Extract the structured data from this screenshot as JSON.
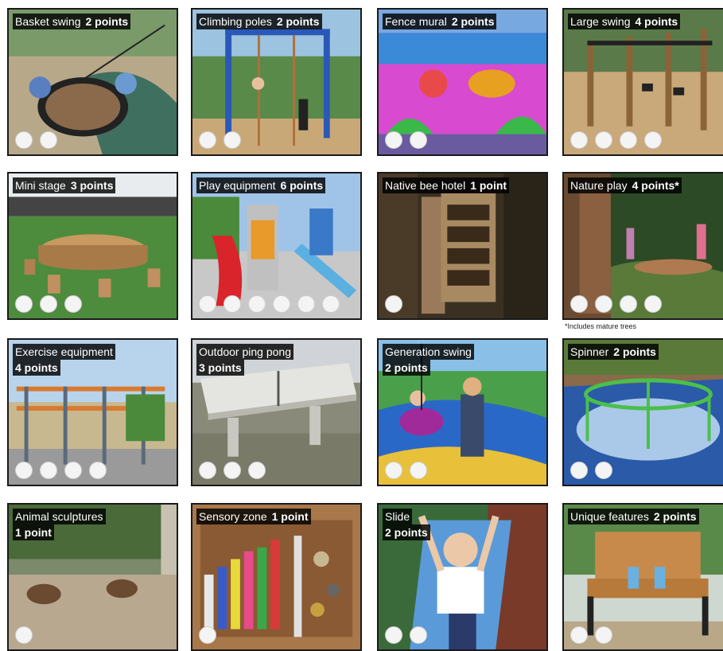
{
  "cards": [
    {
      "name": "Basket swing",
      "points": "2 points",
      "dots": 2,
      "two_line": false
    },
    {
      "name": "Climbing poles",
      "points": "2 points",
      "dots": 2,
      "two_line": false
    },
    {
      "name": "Fence mural",
      "points": "2 points",
      "dots": 2,
      "two_line": false
    },
    {
      "name": "Large swing",
      "points": "4 points",
      "dots": 4,
      "two_line": false
    },
    {
      "name": "Mini stage",
      "points": "3 points",
      "dots": 3,
      "two_line": false
    },
    {
      "name": "Play equipment",
      "points": "6 points",
      "dots": 6,
      "two_line": false
    },
    {
      "name": "Native bee hotel",
      "points": "1 point",
      "dots": 1,
      "two_line": false
    },
    {
      "name": "Nature play",
      "points": "4 points*",
      "dots": 4,
      "two_line": false
    },
    {
      "name": "Exercise equipment",
      "points": "4 points",
      "dots": 4,
      "two_line": true
    },
    {
      "name": "Outdoor ping pong",
      "points": "3 points",
      "dots": 3,
      "two_line": true
    },
    {
      "name": "Generation swing",
      "points": "2 points",
      "dots": 2,
      "two_line": true
    },
    {
      "name": "Spinner",
      "points": "2 points",
      "dots": 2,
      "two_line": false
    },
    {
      "name": "Animal sculptures",
      "points": "1 point",
      "dots": 1,
      "two_line": true
    },
    {
      "name": "Sensory zone",
      "points": "1 point",
      "dots": 1,
      "two_line": false
    },
    {
      "name": "Slide",
      "points": "2 points",
      "dots": 2,
      "two_line": true
    },
    {
      "name": "Unique features",
      "points": "2 points",
      "dots": 2,
      "two_line": false
    }
  ],
  "footnote": "*Includes mature trees"
}
